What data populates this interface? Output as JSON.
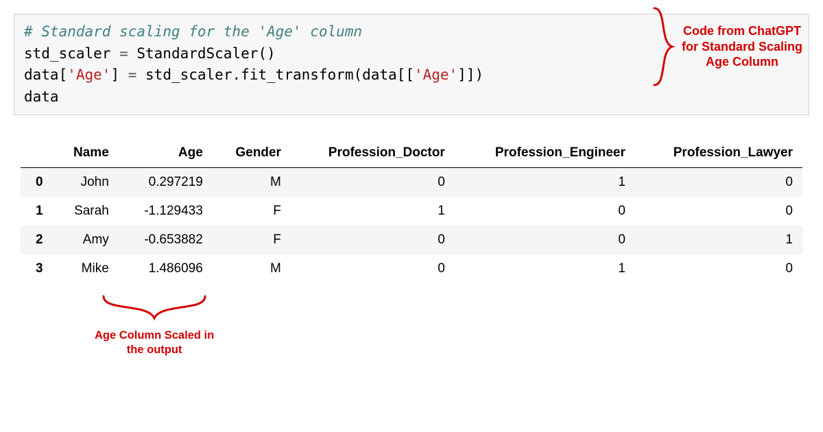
{
  "code": {
    "line1_comment": "# Standard scaling for the 'Age' column",
    "line2_left": "std_scaler ",
    "line2_eq": "=",
    "line2_right": " StandardScaler()",
    "line3_a": "data[",
    "line3_str1": "'Age'",
    "line3_b": "] ",
    "line3_eq": "=",
    "line3_c": " std_scaler.fit_transform(data[[",
    "line3_str2": "'Age'",
    "line3_d": "]])",
    "line4": "data"
  },
  "annotations": {
    "right_line1": "Code from ChatGPT",
    "right_line2": "for Standard Scaling",
    "right_line3": "Age Column",
    "bottom_line1": "Age Column Scaled in",
    "bottom_line2": "the output"
  },
  "table": {
    "columns": [
      "Name",
      "Age",
      "Gender",
      "Profession_Doctor",
      "Profession_Engineer",
      "Profession_Lawyer"
    ],
    "rows": [
      {
        "idx": "0",
        "Name": "John",
        "Age": "0.297219",
        "Gender": "M",
        "Profession_Doctor": "0",
        "Profession_Engineer": "1",
        "Profession_Lawyer": "0"
      },
      {
        "idx": "1",
        "Name": "Sarah",
        "Age": "-1.129433",
        "Gender": "F",
        "Profession_Doctor": "1",
        "Profession_Engineer": "0",
        "Profession_Lawyer": "0"
      },
      {
        "idx": "2",
        "Name": "Amy",
        "Age": "-0.653882",
        "Gender": "F",
        "Profession_Doctor": "0",
        "Profession_Engineer": "0",
        "Profession_Lawyer": "1"
      },
      {
        "idx": "3",
        "Name": "Mike",
        "Age": "1.486096",
        "Gender": "M",
        "Profession_Doctor": "0",
        "Profession_Engineer": "1",
        "Profession_Lawyer": "0"
      }
    ]
  }
}
